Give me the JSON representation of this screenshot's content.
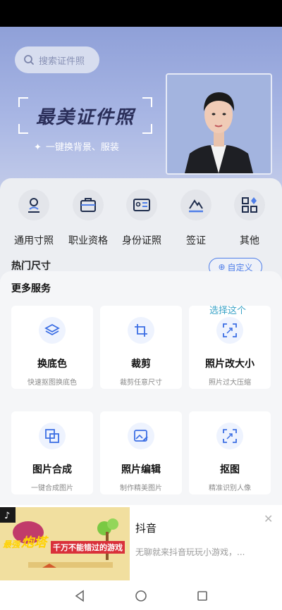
{
  "search": {
    "placeholder": "搜索证件照"
  },
  "hero": {
    "title": "最美证件照",
    "subtitle": "一键换背景、服装"
  },
  "categories": [
    {
      "label": "通用寸照",
      "icon": "person-id-icon"
    },
    {
      "label": "职业资格",
      "icon": "briefcase-icon"
    },
    {
      "label": "身份证照",
      "icon": "id-card-icon"
    },
    {
      "label": "签证",
      "icon": "mountain-visa-icon"
    },
    {
      "label": "其他",
      "icon": "grid-more-icon"
    }
  ],
  "hot": {
    "title": "热门尺寸",
    "custom_label": "自定义"
  },
  "more_services": {
    "title": "更多服务",
    "items": [
      {
        "name": "换底色",
        "desc": "快速抠图换底色",
        "icon": "layers-icon"
      },
      {
        "name": "裁剪",
        "desc": "裁剪任意尺寸",
        "icon": "crop-icon"
      },
      {
        "name": "照片改大小",
        "desc": "照片过大压缩",
        "icon": "kb-resize-icon"
      },
      {
        "name": "图片合成",
        "desc": "一键合成图片",
        "icon": "merge-icon"
      },
      {
        "name": "照片编辑",
        "desc": "制作精美图片",
        "icon": "image-edit-icon"
      },
      {
        "name": "抠图",
        "desc": "精准识别人像",
        "icon": "kb-cutout-icon"
      }
    ]
  },
  "annotation": "选择这个",
  "ad": {
    "app_name": "抖音",
    "description": "无聊就来抖音玩玩小游戏，...",
    "banner_text_1": "最强",
    "banner_text_2": "炮塔",
    "banner_text_3": "千万不能错过的游戏"
  },
  "colors": {
    "accent": "#4f7ee8",
    "hero_top": "#8fa0d8",
    "annotation": "#3aa3c7"
  }
}
